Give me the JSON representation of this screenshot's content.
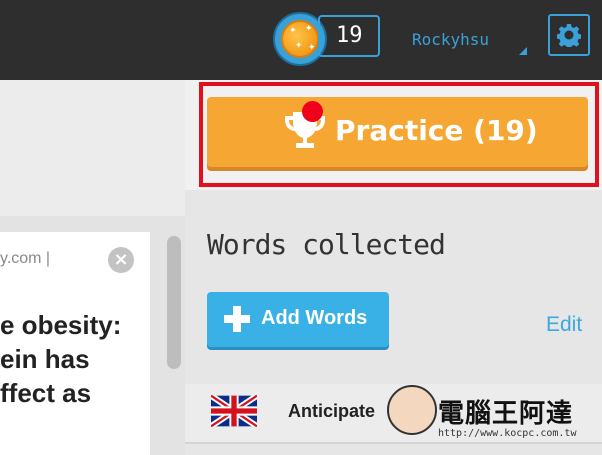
{
  "header": {
    "coins": "19",
    "username": "Rockyhsu",
    "colors": {
      "bar": "#2e2e2e",
      "accent": "#3aa0d8",
      "coin": "#f39a17"
    }
  },
  "article": {
    "source_fragment": "y.com |",
    "headline_lines": [
      "e obesity:",
      "ein has",
      "ffect as"
    ]
  },
  "panel": {
    "practice_label": "Practice (19)",
    "words_collected_title": "Words collected",
    "add_words_label": "Add Words",
    "edit_label": "Edit",
    "words": [
      {
        "flag": "uk-flag-icon",
        "word": "Anticipate"
      }
    ]
  },
  "watermark": {
    "brand": "電腦王阿達",
    "url": "http://www.kocpc.com.tw"
  },
  "colors": {
    "practice": "#f6a632",
    "add_words": "#3ab1e6",
    "highlight": "#e0111d",
    "notification_dot": "#f0001a"
  }
}
